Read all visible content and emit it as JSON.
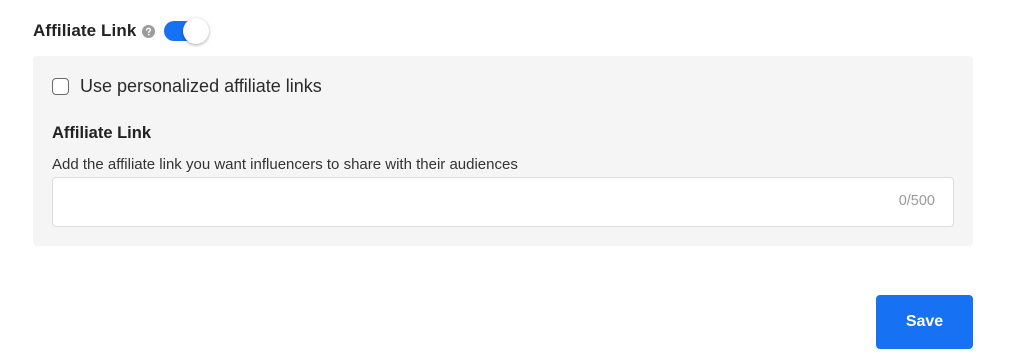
{
  "header": {
    "title": "Affiliate Link",
    "help_icon": "question-circle-icon",
    "toggle_enabled": true
  },
  "panel": {
    "checkbox_label": "Use personalized affiliate links",
    "checkbox_checked": false,
    "field_title": "Affiliate Link",
    "field_description": "Add the affiliate link you want influencers to share with their audiences",
    "input_value": "",
    "char_count": "0/500"
  },
  "actions": {
    "save_label": "Save"
  },
  "colors": {
    "accent": "#1672f3",
    "panel_bg": "#f5f5f5"
  }
}
